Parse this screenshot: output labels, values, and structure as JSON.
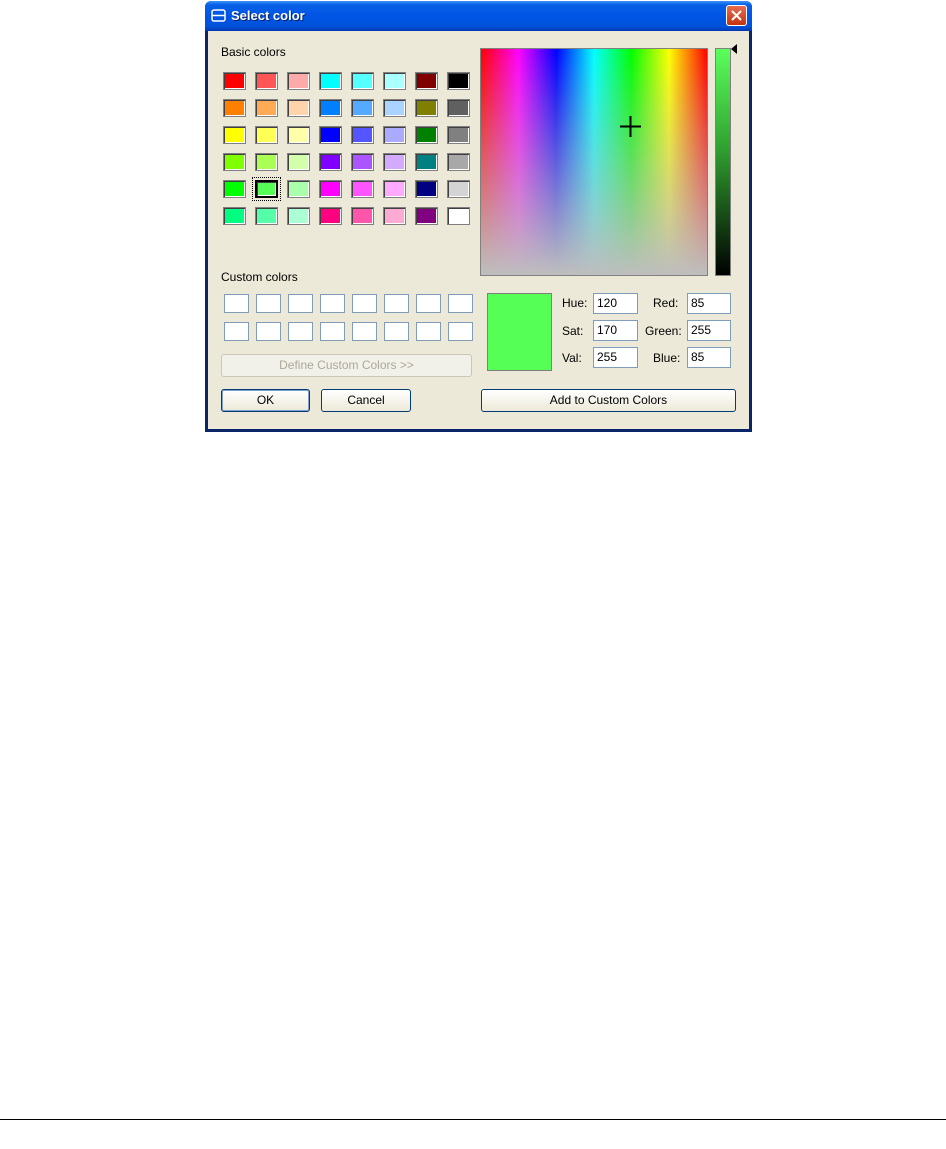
{
  "window": {
    "title": "Select color"
  },
  "labels": {
    "basic_colors": "Basic colors",
    "custom_colors": "Custom colors",
    "hue": "Hue:",
    "sat": "Sat:",
    "val": "Val:",
    "red": "Red:",
    "green": "Green:",
    "blue": "Blue:"
  },
  "values": {
    "hue": "120",
    "sat": "170",
    "val": "255",
    "red": "85",
    "green": "255",
    "blue": "85"
  },
  "buttons": {
    "define_custom": "Define Custom Colors >>",
    "ok": "OK",
    "cancel": "Cancel",
    "add_custom": "Add to Custom Colors"
  },
  "basic_colors": [
    "#ff0000",
    "#ff5555",
    "#ffaaaa",
    "#00ffff",
    "#55ffff",
    "#aaffff",
    "#800000",
    "#000000",
    "#ff8000",
    "#ffaa55",
    "#ffd4aa",
    "#0080ff",
    "#55aaff",
    "#aad4ff",
    "#808000",
    "#606060",
    "#ffff00",
    "#ffff55",
    "#ffffaa",
    "#0000ff",
    "#5555ff",
    "#aaaaff",
    "#008000",
    "#808080",
    "#80ff00",
    "#aaff55",
    "#d4ffaa",
    "#8000ff",
    "#aa55ff",
    "#d4aaff",
    "#008080",
    "#a8a8a8",
    "#00ff00",
    "#55ff55",
    "#aaffaa",
    "#ff00ff",
    "#ff55ff",
    "#ffaaff",
    "#000080",
    "#d4d4d4",
    "#00ff80",
    "#55ffaa",
    "#aaffd4",
    "#ff0080",
    "#ff55aa",
    "#ffaad4",
    "#800080",
    "#ffffff"
  ],
  "selected_basic_index": 33,
  "current_color": "#55ff55"
}
